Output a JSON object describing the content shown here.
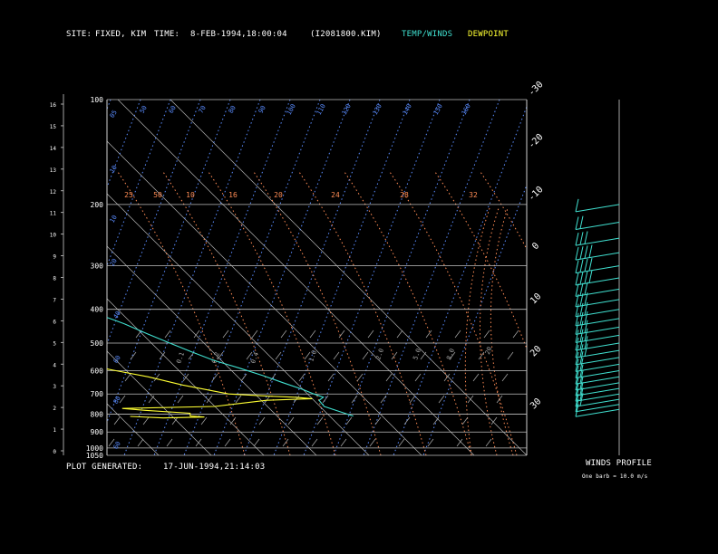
{
  "header": {
    "site_label": "SITE:",
    "site_value": "FIXED, KIM",
    "time_label": "TIME:",
    "time_value": "8-FEB-1994,18:00:04",
    "file_id": "(I2081800.KIM)",
    "temp_winds_legend": "TEMP/WINDS",
    "dewpoint_legend": "DEWPOINT"
  },
  "footer": {
    "plot_generated_label": "PLOT GENERATED:",
    "plot_generated_value": "17-JUN-1994,21:14:03",
    "winds_profile_label": "WINDS PROFILE",
    "barb_note": "One barb = 10.0 m/s"
  },
  "colors": {
    "temperature": "#40e0d0",
    "dewpoint": "#ffff33",
    "isobar": "#bfbfbf",
    "isotherm": "#b3b3b3",
    "mixing_ratio": "#5a8cff",
    "dry_adiabat": "#ff8c55",
    "moist_adiabat": "#a0a0a0",
    "wind_barb": "#40e0d0"
  },
  "chart_data": {
    "type": "line",
    "diagram": "skew-T log-p",
    "pressure_levels": [
      "100",
      "200",
      "300",
      "400",
      "500",
      "600",
      "700",
      "800",
      "900",
      "1000",
      "1050"
    ],
    "height_ticks": [
      "0",
      "1",
      "2",
      "3",
      "4",
      "5",
      "6",
      "7",
      "8",
      "9",
      "10",
      "11",
      "12",
      "13",
      "14",
      "15",
      "16"
    ],
    "isotherm_labels_top": [
      "-110",
      "-100",
      "-90",
      "-80",
      "-70",
      "-60",
      "-50",
      "-40"
    ],
    "isotherm_labels_right": [
      "-30",
      "-20",
      "-10",
      "0",
      "10",
      "20",
      "30"
    ],
    "isotherms": [
      -130,
      -120,
      -110,
      -100,
      -90,
      -80,
      -70,
      -60,
      -50,
      -40,
      -30,
      -20,
      -10,
      0,
      10,
      20,
      30,
      40
    ],
    "mixing_ratio_labels": [
      "05",
      "10",
      "50",
      "60",
      "70",
      "80",
      "90",
      "100",
      "110",
      "120",
      "130",
      "140",
      "150",
      "160"
    ],
    "dry_adiabat_labels": [
      "25",
      "50",
      "10",
      "16",
      "20",
      "24",
      "28",
      "32"
    ],
    "moist_adiabat_labels": [
      "0.1",
      "0.2",
      "0.4",
      "1.0",
      "2.0",
      "5.0",
      "8.0",
      "20"
    ],
    "ylim": [
      1050,
      100
    ],
    "xlim": [
      -40,
      40
    ],
    "series": [
      {
        "name": "TEMP/WINDS",
        "points": [
          [
            200,
            -53.2
          ],
          [
            215,
            -52.3
          ],
          [
            225,
            -51.5
          ],
          [
            235,
            -51.8
          ],
          [
            250,
            -48.0
          ],
          [
            265,
            -46.0
          ],
          [
            280,
            -42.0
          ],
          [
            300,
            -39.0
          ],
          [
            315,
            -34.5
          ],
          [
            330,
            -32.5
          ],
          [
            345,
            -28.0
          ],
          [
            360,
            -23.5
          ],
          [
            375,
            -21.0
          ],
          [
            390,
            -18.5
          ],
          [
            410,
            -15.0
          ],
          [
            440,
            -11.5
          ],
          [
            470,
            -9.0
          ],
          [
            500,
            -6.5
          ],
          [
            530,
            -4.0
          ],
          [
            560,
            -1.5
          ],
          [
            590,
            2.0
          ],
          [
            620,
            5.0
          ],
          [
            650,
            7.5
          ],
          [
            680,
            10.0
          ],
          [
            700,
            11.2
          ],
          [
            715,
            12.4
          ],
          [
            730,
            11.0
          ],
          [
            760,
            10.8
          ],
          [
            790,
            13.0
          ],
          [
            810,
            14.5
          ]
        ]
      },
      {
        "name": "DEWPOINT",
        "points": [
          [
            195,
            -97.5
          ],
          [
            210,
            -98.5
          ],
          [
            230,
            -96.0
          ],
          [
            245,
            -90.5
          ],
          [
            260,
            -90.3
          ],
          [
            268,
            -100.0
          ],
          [
            275,
            -93.0
          ],
          [
            290,
            -95.0
          ],
          [
            310,
            -90.0
          ],
          [
            330,
            -76.0
          ],
          [
            345,
            -66.0
          ],
          [
            360,
            -57.0
          ],
          [
            375,
            -52.0
          ],
          [
            400,
            -49.0
          ],
          [
            430,
            -45.0
          ],
          [
            460,
            -40.0
          ],
          [
            490,
            -36.5
          ],
          [
            515,
            -35.0
          ],
          [
            545,
            -30.5
          ],
          [
            565,
            -31.0
          ],
          [
            580,
            -26.0
          ],
          [
            600,
            -22.0
          ],
          [
            625,
            -17.0
          ],
          [
            660,
            -12.0
          ],
          [
            700,
            -5.0
          ],
          [
            710,
            2.0
          ],
          [
            715,
            7.0
          ],
          [
            722,
            10.0
          ],
          [
            730,
            1.0
          ],
          [
            760,
            -10.0
          ],
          [
            770,
            -28.0
          ],
          [
            780,
            -24.0
          ],
          [
            795,
            -16.0
          ],
          [
            810,
            -16.5
          ],
          [
            815,
            -14.0
          ],
          [
            820,
            -22.0
          ],
          [
            812,
            -28.0
          ]
        ]
      }
    ],
    "winds": [
      {
        "p": 200,
        "speed": 10,
        "dir": 270
      },
      {
        "p": 225,
        "speed": 20,
        "dir": 265
      },
      {
        "p": 250,
        "speed": 30,
        "dir": 265
      },
      {
        "p": 275,
        "speed": 40,
        "dir": 270
      },
      {
        "p": 300,
        "speed": 40,
        "dir": 275
      },
      {
        "p": 325,
        "speed": 40,
        "dir": 275
      },
      {
        "p": 350,
        "speed": 30,
        "dir": 270
      },
      {
        "p": 375,
        "speed": 30,
        "dir": 270
      },
      {
        "p": 400,
        "speed": 30,
        "dir": 265
      },
      {
        "p": 425,
        "speed": 30,
        "dir": 262
      },
      {
        "p": 450,
        "speed": 30,
        "dir": 262
      },
      {
        "p": 475,
        "speed": 30,
        "dir": 260
      },
      {
        "p": 500,
        "speed": 30,
        "dir": 262
      },
      {
        "p": 525,
        "speed": 30,
        "dir": 262
      },
      {
        "p": 550,
        "speed": 20,
        "dir": 260
      },
      {
        "p": 575,
        "speed": 20,
        "dir": 255
      },
      {
        "p": 600,
        "speed": 20,
        "dir": 258
      },
      {
        "p": 625,
        "speed": 20,
        "dir": 250
      },
      {
        "p": 650,
        "speed": 20,
        "dir": 245
      },
      {
        "p": 675,
        "speed": 20,
        "dir": 240
      },
      {
        "p": 700,
        "speed": 20,
        "dir": 235
      },
      {
        "p": 725,
        "speed": 20,
        "dir": 225
      },
      {
        "p": 750,
        "speed": 10,
        "dir": 220
      },
      {
        "p": 775,
        "speed": 10,
        "dir": 220
      }
    ]
  }
}
